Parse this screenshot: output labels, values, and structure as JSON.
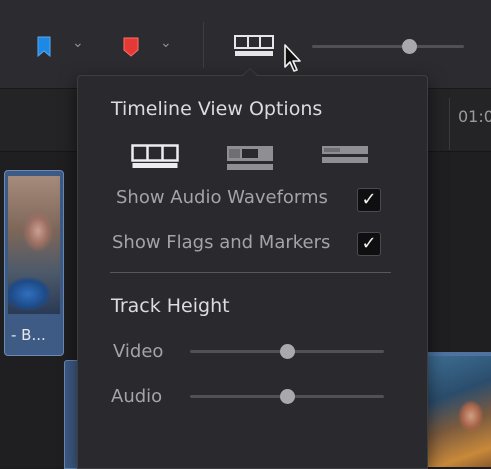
{
  "toolbar": {
    "flag_color": "#1e88e5",
    "marker_color": "#e53935",
    "dropdown_chevron": "⌄",
    "zoom_slider_value": 0.64
  },
  "timeline": {
    "ruler_timecode": "01:0",
    "clip_label": "- B..."
  },
  "popover": {
    "title": "Timeline View Options",
    "view_modes": [
      {
        "name": "film-strip-view",
        "selected": true
      },
      {
        "name": "thumbnail-view",
        "selected": false
      },
      {
        "name": "simple-view",
        "selected": false
      }
    ],
    "options": [
      {
        "label": "Show Audio Waveforms",
        "checked": true,
        "mark": "✓"
      },
      {
        "label": "Show Flags and Markers",
        "checked": true,
        "mark": "✓"
      }
    ],
    "track_height": {
      "title": "Track Height",
      "video_label": "Video",
      "video_value": 0.5,
      "audio_label": "Audio",
      "audio_value": 0.5
    }
  }
}
